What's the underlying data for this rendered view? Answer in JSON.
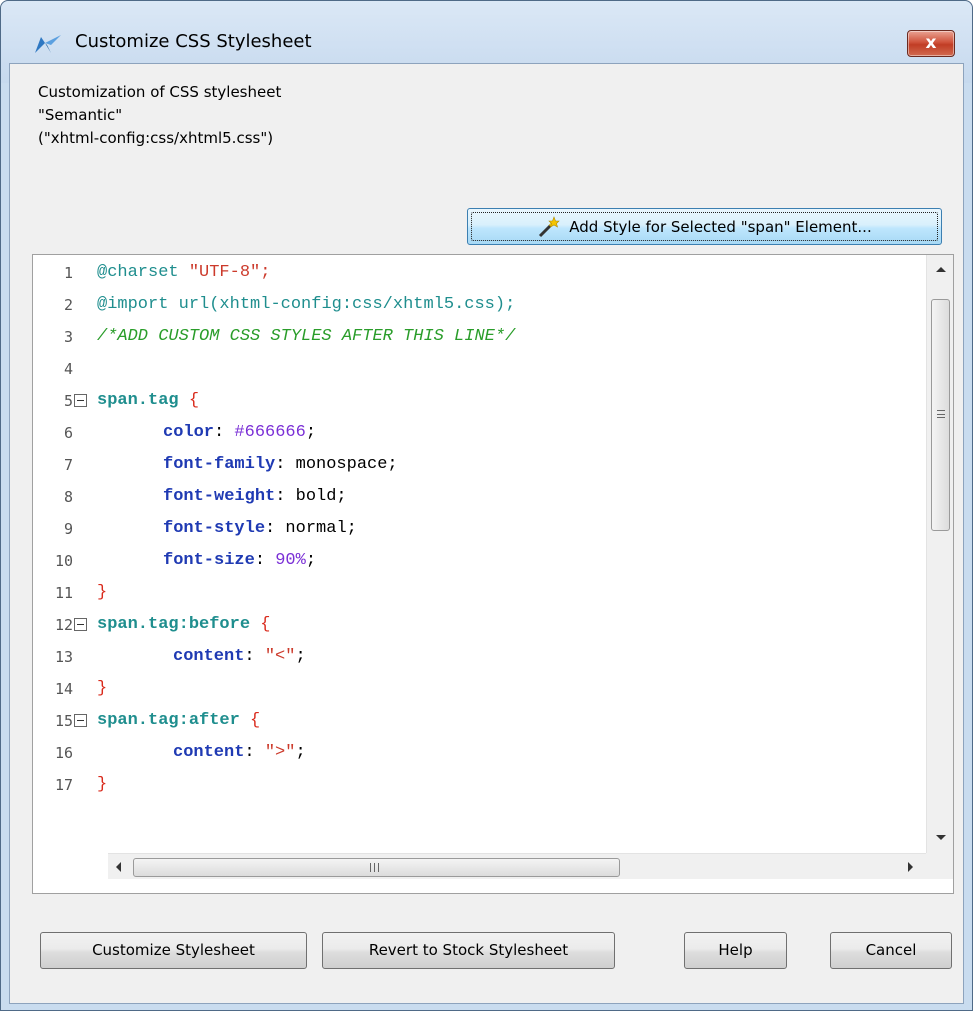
{
  "window": {
    "title": "Customize CSS Stylesheet",
    "close_label": "x"
  },
  "description": {
    "line1": "Customization of CSS stylesheet",
    "line2": "\"Semantic\"",
    "line3": "(\"xhtml-config:css/xhtml5.css\")"
  },
  "toolbar": {
    "add_style_label": "Add Style for Selected \"span\" Element..."
  },
  "editor": {
    "lines": [
      {
        "n": "1"
      },
      {
        "n": "2"
      },
      {
        "n": "3"
      },
      {
        "n": "4"
      },
      {
        "n": "5"
      },
      {
        "n": "6"
      },
      {
        "n": "7"
      },
      {
        "n": "8"
      },
      {
        "n": "9"
      },
      {
        "n": "10"
      },
      {
        "n": "11"
      },
      {
        "n": "12"
      },
      {
        "n": "13"
      },
      {
        "n": "14"
      },
      {
        "n": "15"
      },
      {
        "n": "16"
      },
      {
        "n": "17"
      }
    ],
    "code": {
      "l1a": "@charset",
      "l1b": " \"UTF-8\";",
      "l2a": "@import",
      "l2b": " url",
      "l2c": "(xhtml-config:css/xhtml5.css);",
      "l3": "/*ADD CUSTOM CSS STYLES AFTER THIS LINE*/",
      "l5a": "span.tag",
      "l5b": " {",
      "l6a": "color",
      "l6b": ": ",
      "l6c": "#666666",
      "l6d": ";",
      "l7a": "font-family",
      "l7b": ": monospace;",
      "l8a": "font-weight",
      "l8b": ": bold;",
      "l9a": "font-style",
      "l9b": ": normal;",
      "l10a": "font-size",
      "l10b": ": ",
      "l10c": "90%",
      "l10d": ";",
      "l11": "}",
      "l12a": "span.tag:before",
      "l12b": " {",
      "l13a": "content",
      "l13b": ": ",
      "l13c": "\"<\"",
      "l13d": ";",
      "l14": "}",
      "l15a": "span.tag:after",
      "l15b": " {",
      "l16a": "content",
      "l16b": ": ",
      "l16c": "\">\"",
      "l16d": ";",
      "l17": "}"
    },
    "hscroll_grip": "III"
  },
  "buttons": {
    "customize": "Customize Stylesheet",
    "revert": "Revert to Stock Stylesheet",
    "help": "Help",
    "cancel": "Cancel"
  }
}
